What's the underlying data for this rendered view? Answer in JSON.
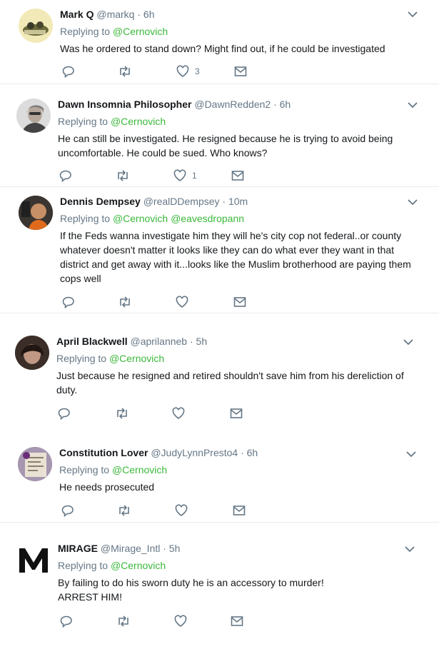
{
  "colors": {
    "mention": "#3bb83b",
    "muted": "#657786",
    "icon": "#657786",
    "divider": "#e6ecf0"
  },
  "tweets": [
    {
      "name": "Mark Q",
      "handle": "@markq",
      "time": "· 6h",
      "replying_label": "Replying to",
      "mentions": "@Cernovich",
      "text": [
        "Was he ordered to stand down? Might find out, if he could be investigated"
      ],
      "reply_count": "",
      "retweet_count": "",
      "like_count": "3",
      "avatar": "photo-group"
    },
    {
      "name": "Dawn Insomnia Philosopher",
      "handle": "@DawnRedden2",
      "time": "· 6h",
      "replying_label": "Replying to",
      "mentions": "@Cernovich",
      "text": [
        "He can still be investigated.  He resigned because he is trying to avoid being",
        "uncomfortable. He could be sued. Who knows?"
      ],
      "reply_count": "",
      "retweet_count": "",
      "like_count": "1",
      "avatar": "photo-woman"
    },
    {
      "name": "Dennis Dempsey",
      "handle": "@realDDempsey",
      "time": "· 10m",
      "replying_label": "Replying to",
      "mentions": "@Cernovich @eavesdropann",
      "text": [
        "If the Feds wanna investigate him they will he's city cop not federal..or county",
        "whatever doesn't matter it looks like they can do what ever they want in that",
        "district and get away with it...looks like the Muslim brotherhood are paying them",
        "cops well"
      ],
      "reply_count": "",
      "retweet_count": "",
      "like_count": "",
      "avatar": "photo-man"
    },
    {
      "name": "April Blackwell",
      "handle": "@aprilanneb",
      "time": "· 5h",
      "replying_label": "Replying to",
      "mentions": "@Cernovich",
      "text": [
        "Just because he resigned and retired shouldn't save him from his dereliction of",
        "duty."
      ],
      "reply_count": "",
      "retweet_count": "",
      "like_count": "",
      "avatar": "photo-woman-dark"
    },
    {
      "name": "Constitution Lover",
      "handle": "@JudyLynnPresto4",
      "time": "· 6h",
      "replying_label": "Replying to",
      "mentions": "@Cernovich",
      "text": [
        "He needs prosecuted"
      ],
      "reply_count": "",
      "retweet_count": "",
      "like_count": "",
      "avatar": "photo-card"
    },
    {
      "name": "MIRAGE",
      "handle": "@Mirage_Intl",
      "time": "· 5h",
      "replying_label": "Replying to",
      "mentions": "@Cernovich",
      "text": [
        "By failing to do his sworn duty he is an accessory to murder!",
        "ARREST HIM!"
      ],
      "reply_count": "",
      "retweet_count": "",
      "like_count": "",
      "avatar": "logo-m"
    }
  ]
}
